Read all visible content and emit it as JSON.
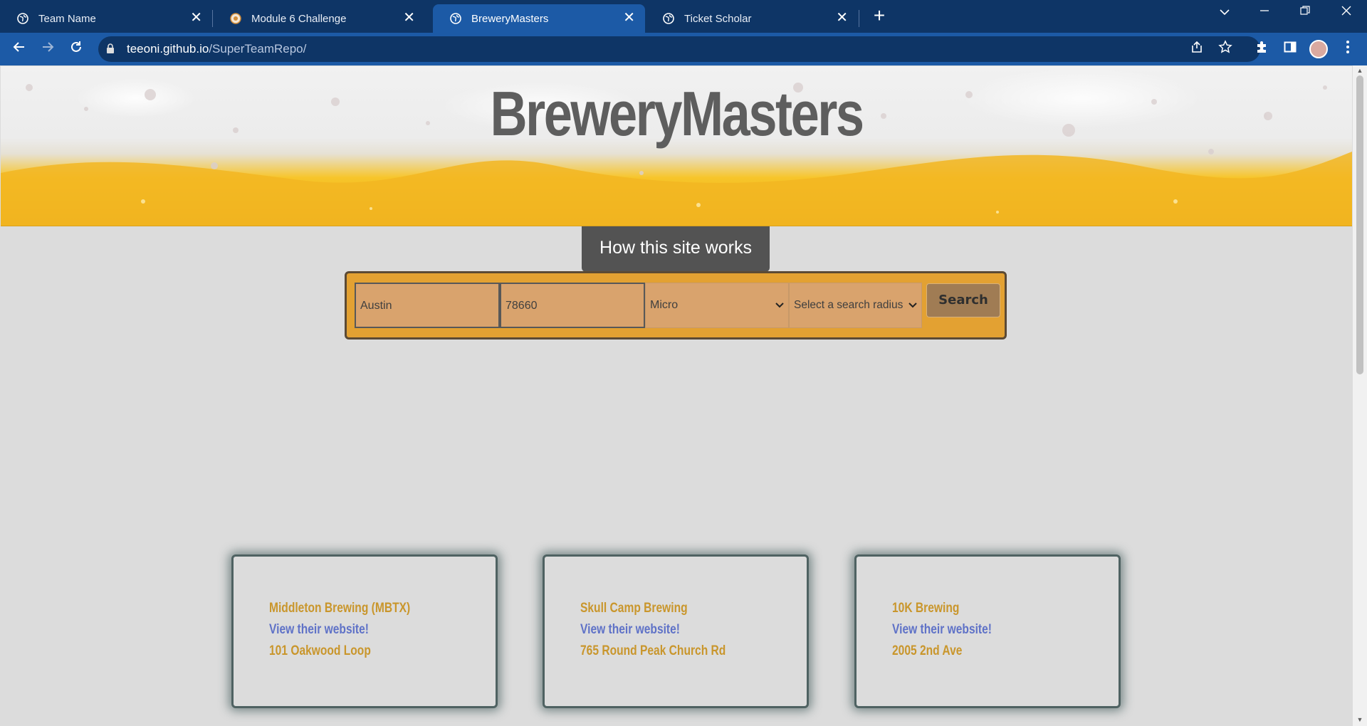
{
  "browser": {
    "tabs": [
      {
        "title": "Team Name",
        "icon": "globe-icon",
        "active": false
      },
      {
        "title": "Module 6 Challenge",
        "icon": "site-favicon",
        "active": false
      },
      {
        "title": "BreweryMasters",
        "icon": "globe-icon",
        "active": true
      },
      {
        "title": "Ticket Scholar",
        "icon": "globe-icon",
        "active": false
      }
    ],
    "url_host": "teeoni.github.io",
    "url_path": "/SuperTeamRepo/",
    "close_glyph": "✕",
    "new_tab_glyph": "+",
    "colors": {
      "frame": "#0e3566",
      "toolbar": "#1c5aa6"
    }
  },
  "page": {
    "title": "BreweryMasters",
    "how_button": "How this site works",
    "search": {
      "city_value": "Austin",
      "zip_value": "78660",
      "type_selected": "Micro",
      "radius_selected": "Select a search radius",
      "button": "Search"
    },
    "results": [
      {
        "name": "Middleton Brewing (MBTX)",
        "website": "View their website!",
        "address": "101 Oakwood Loop"
      },
      {
        "name": "Skull Camp Brewing",
        "website": "View their website!",
        "address": "765 Round Peak Church Rd"
      },
      {
        "name": "10K Brewing",
        "website": "View their website!",
        "address": "2005 2nd Ave"
      }
    ],
    "colors": {
      "accent": "#e3a132",
      "card_text": "#c9962c",
      "link": "#5f72c7",
      "title": "#5e5e5e"
    }
  }
}
